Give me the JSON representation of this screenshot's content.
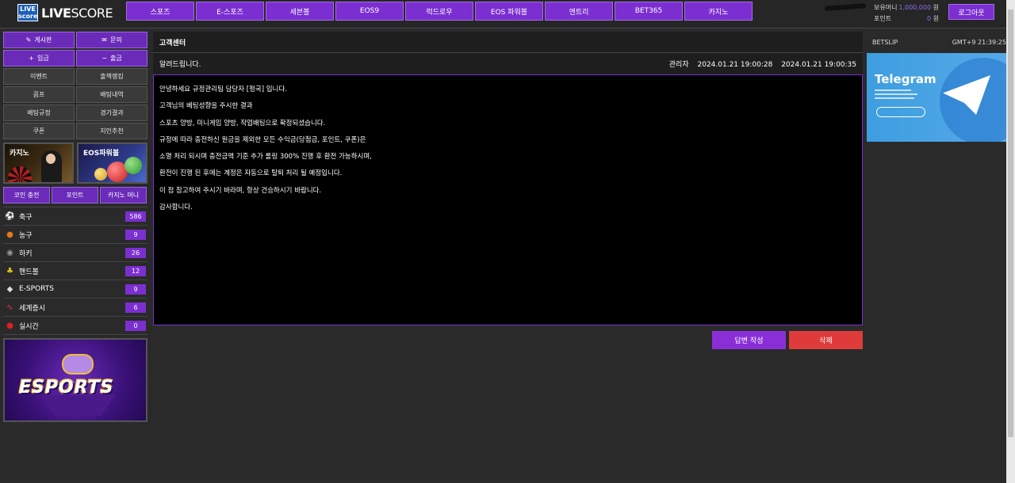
{
  "header": {
    "logo_badge": "LIVE score",
    "logo_live": "LIVE",
    "logo_score": "SCORE",
    "nav": [
      "스포즈",
      "E-스포즈",
      "세븐볼",
      "EOS9",
      "럭드로우",
      "EOS 파워볼",
      "엔트리",
      "BET365",
      "카지노"
    ],
    "money_label": "보유머니",
    "money_value": "1,000,000",
    "money_unit": "원",
    "point_label": "포인트",
    "point_value": "0",
    "point_unit": "원",
    "logout": "로그아웃"
  },
  "sidebar": {
    "top_buttons": [
      {
        "icon": "✎",
        "label": "게시판"
      },
      {
        "icon": "✉",
        "label": "문의"
      },
      {
        "icon": "+",
        "label": "입금"
      },
      {
        "icon": "−",
        "label": "출금"
      }
    ],
    "gray_buttons": [
      "이벤트",
      "출첵랭킹",
      "콤프",
      "배팅내역",
      "배팅규정",
      "경기결과",
      "쿠폰",
      "지인추천"
    ],
    "promo_casino": "카지노",
    "promo_eos": "EOS파워볼",
    "small_buttons": [
      "코인 충전",
      "포인트",
      "카지노 머니"
    ],
    "sports": [
      {
        "name": "축구",
        "count": "586",
        "icon": "⚽"
      },
      {
        "name": "농구",
        "count": "9",
        "icon": "●"
      },
      {
        "name": "하키",
        "count": "26",
        "icon": "◉"
      },
      {
        "name": "핸드볼",
        "count": "12",
        "icon": "♣"
      },
      {
        "name": "E-SPORTS",
        "count": "9",
        "icon": "◆"
      },
      {
        "name": "세계증시",
        "count": "6",
        "icon": "∿"
      },
      {
        "name": "실시간",
        "count": "0",
        "icon": "●"
      }
    ],
    "esports_banner": "ESPORTS"
  },
  "main": {
    "title": "고객센터",
    "notice_title": "알려드립니다.",
    "author": "관리자",
    "created": "2024.01.21 19:00:28",
    "updated": "2024.01.21 19:00:35",
    "body": [
      "안녕하세요 규정관리팀 담당자 [펑국] 입니다.",
      "고객님의 베팅성향을 주시한 결과",
      "스포츠 양방, 미니게임 양방, 작업배팅으로 확정되셨습니다.",
      "규정에 따라 충전하신 원금을 제외한 모든 수익금(당첨금, 포인트, 쿠폰)은",
      "소멸 처리 되시며 충전금액 기준 추가 롤링 300% 진행 후 환전 가능하시며,",
      "환전이 진행 된 후에는 계정은 자동으로 탈퇴 처리 될 예정입니다.",
      "이 점 참고하여 주시기 바라며, 항상 건승하시기 바랍니다.",
      "감사합니다."
    ],
    "reply_button": "답변 작성",
    "delete_button": "삭제"
  },
  "right": {
    "betslip": "BETSLIP",
    "clock": "GMT+9 21:39:25",
    "telegram_title": "Telegram"
  },
  "colors": {
    "accent": "#7b2fd0",
    "delete": "#e03b3b",
    "telegram": "#4aa3e6"
  }
}
